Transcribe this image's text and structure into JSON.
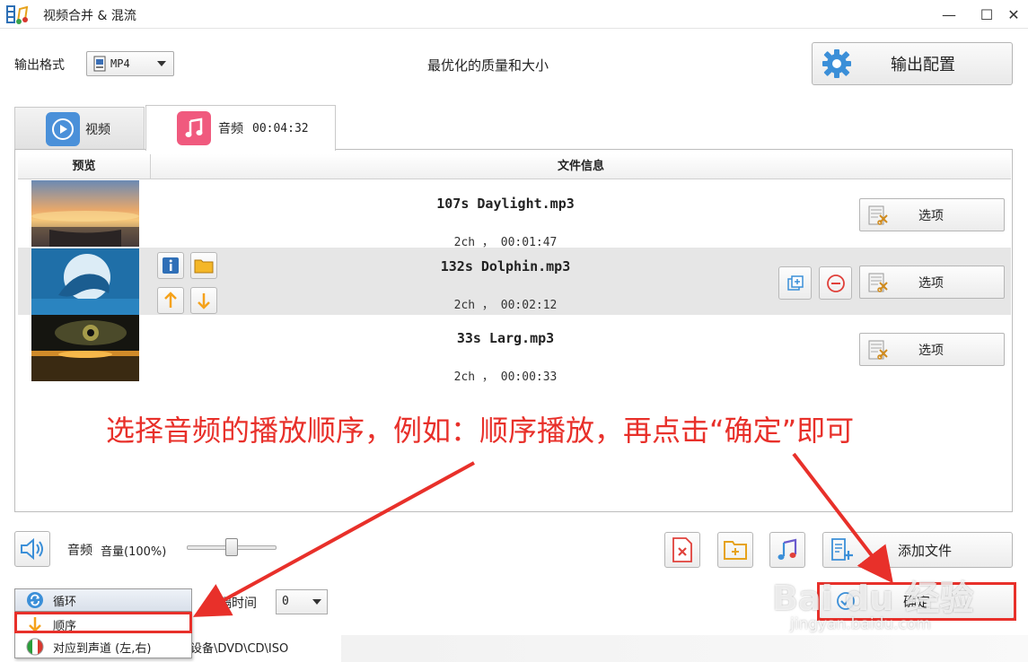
{
  "window": {
    "title": "视频合并 & 混流",
    "minimize": "—",
    "maximize": "☐",
    "close": "✕"
  },
  "top": {
    "format_label": "输出格式",
    "format_value": "MP4",
    "quality_text": "最优化的质量和大小",
    "config_label": "输出配置"
  },
  "tabs": [
    {
      "label": "视频",
      "icon": "play-icon"
    },
    {
      "label": "音频",
      "duration": "00:04:32",
      "icon": "music-icon"
    }
  ],
  "columns": {
    "preview": "预览",
    "file_info": "文件信息"
  },
  "files": [
    {
      "name": "107s Daylight.mp3",
      "info": "2ch ， 00:01:47",
      "option": "选项"
    },
    {
      "name": "132s Dolphin.mp3",
      "info": "2ch ， 00:02:12",
      "option": "选项"
    },
    {
      "name": "33s Larg.mp3",
      "info": "2ch ， 00:00:33",
      "option": "选项"
    }
  ],
  "annotation": "选择音频的播放顺序，例如：顺序播放，再点击“确定”即可",
  "bottom": {
    "audio_label": "音频",
    "volume_label": "音量(100%)",
    "volume_level": 0.5,
    "add_file_label": "添加文件",
    "confirm_label": "确定",
    "interval_label": "间隔时间",
    "interval_value": "0"
  },
  "dropdown": {
    "current": "循环",
    "items": [
      "顺序",
      "对应到声道 (左,右)"
    ]
  },
  "statusbar": {
    "text": "设备\\DVD\\CD\\ISO"
  },
  "watermark": {
    "brand": "Bai du 经验",
    "url": "jingyan.baidu.com"
  },
  "colors": {
    "accent_red": "#e8302a",
    "video_tab_icon": "#4a90d9",
    "audio_tab_icon": "#f05a7e",
    "orange_arrow": "#f5a21b"
  }
}
